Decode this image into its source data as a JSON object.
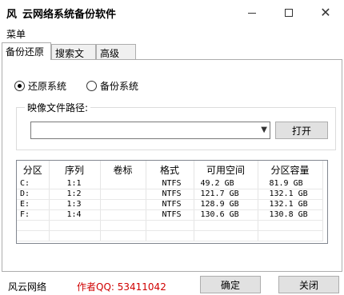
{
  "window": {
    "title": "云网络系统备份软件",
    "icon_char": "风",
    "close_glyph": "✕"
  },
  "menu": {
    "items": [
      "菜单"
    ]
  },
  "tabs": [
    {
      "label": "备份还原",
      "active": true
    },
    {
      "label": "搜索文件",
      "active": false
    },
    {
      "label": "高级",
      "active": false
    }
  ],
  "mode": {
    "options": [
      {
        "label": "还原系统",
        "checked": true
      },
      {
        "label": "备份系统",
        "checked": false
      }
    ]
  },
  "image_path": {
    "legend": "映像文件路径:",
    "value": "",
    "open_label": "打开"
  },
  "table": {
    "columns": [
      "分区",
      "序列",
      "卷标",
      "格式",
      "可用空间",
      "分区容量"
    ],
    "rows": [
      [
        "C:",
        "1:1",
        "",
        "NTFS",
        "49.2 GB",
        "81.9 GB"
      ],
      [
        "D:",
        "1:2",
        "",
        "NTFS",
        "121.7 GB",
        "132.1 GB"
      ],
      [
        "E:",
        "1:3",
        "",
        "NTFS",
        "128.9 GB",
        "132.1 GB"
      ],
      [
        "F:",
        "1:4",
        "",
        "NTFS",
        "130.6 GB",
        "130.8 GB"
      ]
    ]
  },
  "footer": {
    "status": "风云网络",
    "author": "作者QQ: 53411042",
    "ok_label": "确定",
    "close_label": "关闭"
  }
}
